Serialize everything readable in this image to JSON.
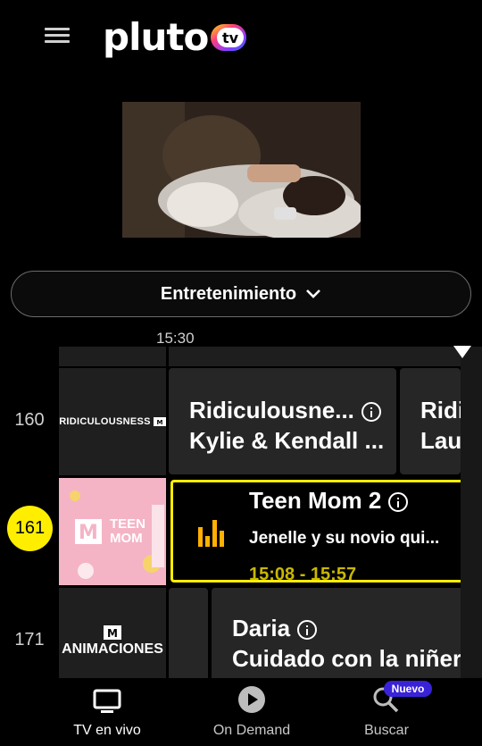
{
  "header": {
    "logo_text": "pluto",
    "logo_suffix": "tv"
  },
  "category": {
    "label": "Entretenimiento"
  },
  "timeline": {
    "marker": "15:30"
  },
  "channels": [
    {
      "number": "160",
      "logo_text": "RIDICULOUSNESS",
      "program_title": "Ridiculousne...",
      "program_subtitle": "Kylie & Kendall ...",
      "next_title": "Ridi",
      "next_subtitle": "Lau"
    },
    {
      "number": "161",
      "program_title": "Teen Mom 2",
      "program_subtitle": "Jenelle y su novio qui...",
      "program_time": "15:08 - 15:57",
      "logo_text_top": "TEEN",
      "logo_text_bottom": "MOM"
    },
    {
      "number": "171",
      "logo_text": "ANIMACIONES",
      "program_title": "Daria",
      "program_subtitle": "Cuidado con la niñera"
    }
  ],
  "bottom_nav": {
    "live_label": "TV en vivo",
    "ondemand_label": "On Demand",
    "search_label": "Buscar",
    "search_badge": "Nuevo"
  },
  "colors": {
    "accent": "#ffee00",
    "badge": "#3a22d8"
  }
}
